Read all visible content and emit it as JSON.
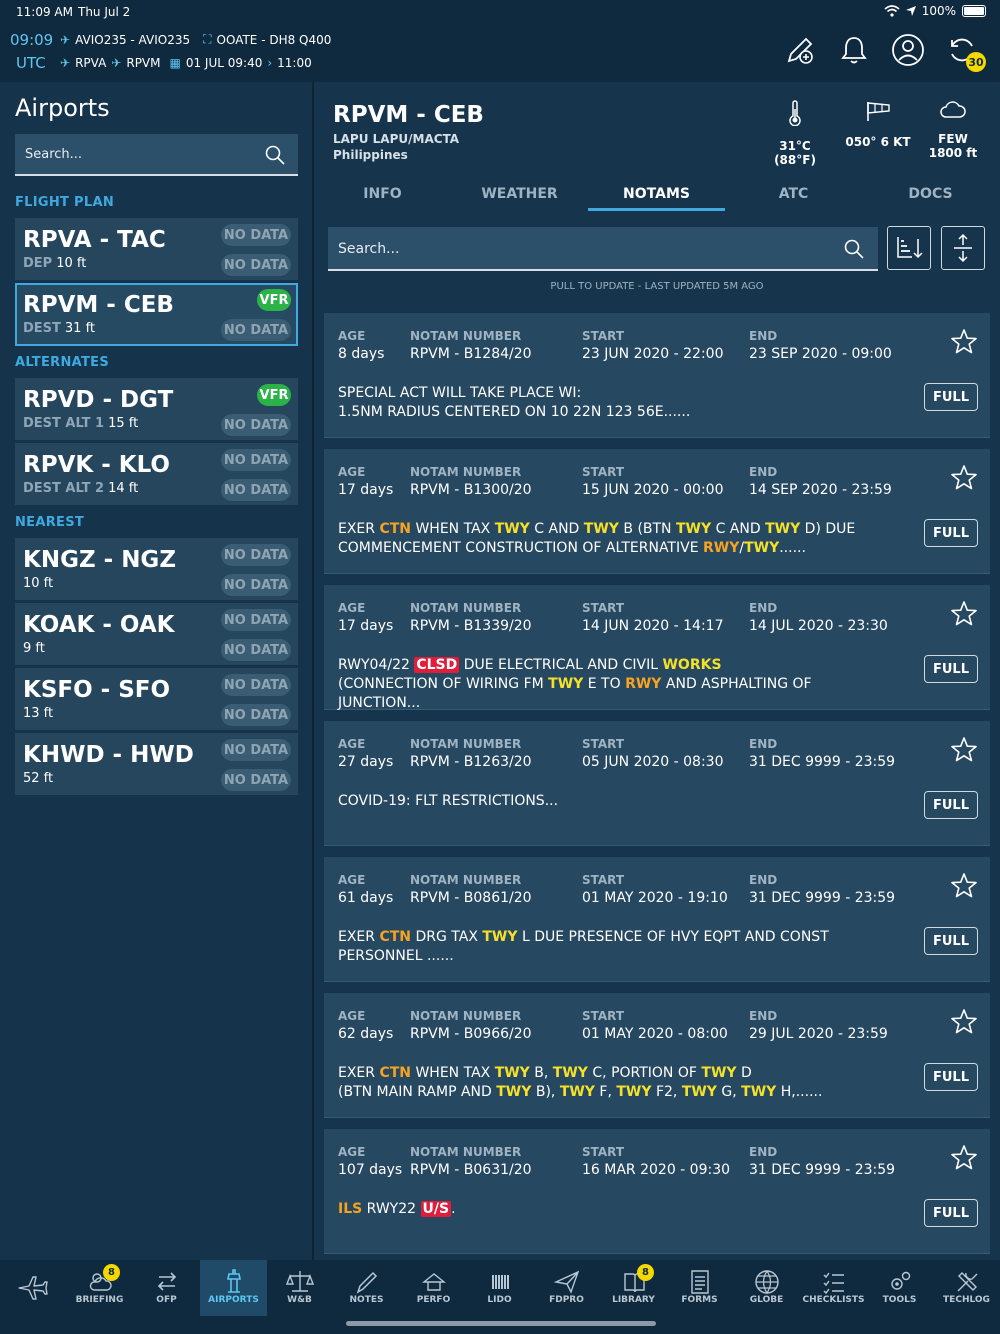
{
  "status": {
    "time": "11:09 AM",
    "date": "Thu Jul 2",
    "battery": "100%"
  },
  "flight": {
    "utc_time": "09:09",
    "utc_label": "UTC",
    "flight_numbers": "AVIO235 - AVIO235",
    "aircraft": "OOATE - DH8 Q400",
    "origin": "RPVA",
    "destination": "RPVM",
    "schedule_date": "01 JUL 09:40",
    "schedule_arrival": "11:00",
    "sync_count": "30"
  },
  "sidebar": {
    "title": "Airports",
    "search_placeholder": "Search...",
    "sections": {
      "flight_plan": "FLIGHT PLAN",
      "alternates": "ALTERNATES",
      "nearest": "NEAREST"
    },
    "airports": [
      {
        "code": "RPVA - TAC",
        "sub_key": "DEP",
        "elev": "10 ft",
        "top_badge": "NO DATA",
        "bottom_badge": "NO DATA"
      },
      {
        "code": "RPVM - CEB",
        "sub_key": "DEST",
        "elev": "31 ft",
        "top_badge": "VFR",
        "bottom_badge": "NO DATA"
      },
      {
        "code": "RPVD - DGT",
        "sub_key": "DEST ALT 1",
        "elev": "15 ft",
        "top_badge": "VFR",
        "bottom_badge": "NO DATA"
      },
      {
        "code": "RPVK - KLO",
        "sub_key": "DEST ALT 2",
        "elev": "14 ft",
        "top_badge": "NO DATA",
        "bottom_badge": "NO DATA"
      },
      {
        "code": "KNGZ - NGZ",
        "sub_key": "",
        "elev": "10 ft",
        "top_badge": "NO DATA",
        "bottom_badge": "NO DATA"
      },
      {
        "code": "KOAK - OAK",
        "sub_key": "",
        "elev": "9 ft",
        "top_badge": "NO DATA",
        "bottom_badge": "NO DATA"
      },
      {
        "code": "KSFO - SFO",
        "sub_key": "",
        "elev": "13 ft",
        "top_badge": "NO DATA",
        "bottom_badge": "NO DATA"
      },
      {
        "code": "KHWD - HWD",
        "sub_key": "",
        "elev": "52 ft",
        "top_badge": "NO DATA",
        "bottom_badge": "NO DATA"
      }
    ]
  },
  "airport": {
    "title": "RPVM - CEB",
    "name": "LAPU LAPU/MACTA",
    "country": "Philippines",
    "temperature": "31°C (88°F)",
    "wind": "050° 6 KT",
    "cloud_cover": "FEW",
    "cloud_base": "1800 ft"
  },
  "tabs": [
    "INFO",
    "WEATHER",
    "NOTAMS",
    "ATC",
    "DOCS"
  ],
  "notams_view": {
    "search_placeholder": "Search...",
    "pull_text": "PULL TO UPDATE - LAST UPDATED 5M AGO",
    "labels": {
      "age": "AGE",
      "number": "NOTAM NUMBER",
      "start": "START",
      "end": "END",
      "full": "FULL"
    }
  },
  "notams": [
    {
      "age": "8 days",
      "number": "RPVM - B1284/20",
      "start": "23 JUN 2020 - 22:00",
      "end": "23 SEP 2020 - 09:00",
      "lines": [
        [
          {
            "t": "SPECIAL ACT WILL TAKE PLACE WI:"
          }
        ],
        [
          {
            "t": "1.5NM RADIUS CENTERED ON 10 22N 123 56E......"
          }
        ]
      ]
    },
    {
      "age": "17 days",
      "number": "RPVM - B1300/20",
      "start": "15 JUN 2020 - 00:00",
      "end": "14 SEP 2020 - 23:59",
      "lines": [
        [
          {
            "t": "EXER "
          },
          {
            "t": "CTN",
            "h": "o"
          },
          {
            "t": " WHEN TAX "
          },
          {
            "t": "TWY",
            "h": "y"
          },
          {
            "t": " C AND "
          },
          {
            "t": "TWY",
            "h": "y"
          },
          {
            "t": " B (BTN "
          },
          {
            "t": "TWY",
            "h": "y"
          },
          {
            "t": " C AND "
          },
          {
            "t": "TWY",
            "h": "y"
          },
          {
            "t": " D) DUE"
          }
        ],
        [
          {
            "t": "COMMENCEMENT CONSTRUCTION OF ALTERNATIVE "
          },
          {
            "t": "RWY",
            "h": "o"
          },
          {
            "t": "/"
          },
          {
            "t": "TWY",
            "h": "y"
          },
          {
            "t": "......"
          }
        ]
      ]
    },
    {
      "age": "17 days",
      "number": "RPVM - B1339/20",
      "start": "14 JUN 2020 - 14:17",
      "end": "14 JUL 2020 - 23:30",
      "lines": [
        [
          {
            "t": "RWY04/22 "
          },
          {
            "t": "CLSD",
            "h": "r"
          },
          {
            "t": " DUE ELECTRICAL AND CIVIL "
          },
          {
            "t": "WORKS",
            "h": "y"
          }
        ],
        [
          {
            "t": "(CONNECTION OF WIRING FM "
          },
          {
            "t": "TWY",
            "h": "y"
          },
          {
            "t": " E TO "
          },
          {
            "t": "RWY",
            "h": "o"
          },
          {
            "t": " AND ASPHALTING OF JUNCTION..."
          }
        ]
      ]
    },
    {
      "age": "27 days",
      "number": "RPVM - B1263/20",
      "start": "05 JUN 2020 - 08:30",
      "end": "31 DEC 9999 - 23:59",
      "lines": [
        [
          {
            "t": "COVID-19: FLT RESTRICTIONS..."
          }
        ]
      ]
    },
    {
      "age": "61 days",
      "number": "RPVM - B0861/20",
      "start": "01 MAY 2020 - 19:10",
      "end": "31 DEC 9999 - 23:59",
      "lines": [
        [
          {
            "t": "EXER "
          },
          {
            "t": "CTN",
            "h": "o"
          },
          {
            "t": " DRG TAX "
          },
          {
            "t": "TWY",
            "h": "y"
          },
          {
            "t": " L DUE PRESENCE OF HVY EQPT AND CONST"
          }
        ],
        [
          {
            "t": "PERSONNEL ......"
          }
        ]
      ]
    },
    {
      "age": "62 days",
      "number": "RPVM - B0966/20",
      "start": "01 MAY 2020 - 08:00",
      "end": "29 JUL 2020 - 23:59",
      "lines": [
        [
          {
            "t": "EXER "
          },
          {
            "t": "CTN",
            "h": "o"
          },
          {
            "t": " WHEN TAX "
          },
          {
            "t": "TWY",
            "h": "y"
          },
          {
            "t": " B, "
          },
          {
            "t": "TWY",
            "h": "y"
          },
          {
            "t": " C, PORTION OF "
          },
          {
            "t": "TWY",
            "h": "y"
          },
          {
            "t": " D"
          }
        ],
        [
          {
            "t": "(BTN MAIN RAMP AND "
          },
          {
            "t": "TWY",
            "h": "y"
          },
          {
            "t": " B), "
          },
          {
            "t": "TWY",
            "h": "y"
          },
          {
            "t": " F, "
          },
          {
            "t": "TWY",
            "h": "y"
          },
          {
            "t": " F2, "
          },
          {
            "t": "TWY",
            "h": "y"
          },
          {
            "t": " G, "
          },
          {
            "t": "TWY",
            "h": "y"
          },
          {
            "t": " H,......"
          }
        ]
      ]
    },
    {
      "age": "107 days",
      "number": "RPVM - B0631/20",
      "start": "16 MAR 2020 - 09:30",
      "end": "31 DEC 9999 - 23:59",
      "lines": [
        [
          {
            "t": "ILS",
            "h": "o"
          },
          {
            "t": " RWY22 "
          },
          {
            "t": "U/S",
            "h": "r"
          },
          {
            "t": "."
          }
        ]
      ]
    }
  ],
  "bottom_nav": [
    {
      "label": "",
      "icon": "plane-icon"
    },
    {
      "label": "BRIEFING",
      "icon": "weather-icon",
      "badge": "8"
    },
    {
      "label": "OFP",
      "icon": "ofp-icon"
    },
    {
      "label": "AIRPORTS",
      "icon": "tower-icon",
      "active": true
    },
    {
      "label": "W&B",
      "icon": "balance-icon"
    },
    {
      "label": "NOTES",
      "icon": "pencil-icon"
    },
    {
      "label": "PERFO",
      "icon": "perfo-icon"
    },
    {
      "label": "LIDO",
      "icon": "lido-icon"
    },
    {
      "label": "FDPRO",
      "icon": "send-icon"
    },
    {
      "label": "LIBRARY",
      "icon": "book-icon",
      "badge": "8"
    },
    {
      "label": "FORMS",
      "icon": "form-icon"
    },
    {
      "label": "GLOBE",
      "icon": "globe-icon"
    },
    {
      "label": "CHECKLISTS",
      "icon": "checklist-icon"
    },
    {
      "label": "TOOLS",
      "icon": "gears-icon"
    },
    {
      "label": "TECHLOG",
      "icon": "wrench-icon"
    }
  ],
  "colors": {
    "accent": "#3fa9e0",
    "vfr": "#2bb34a",
    "badge": "#f5d800",
    "highlight_orange": "#f7a321",
    "highlight_yellow": "#f5e12a",
    "highlight_red": "#e01e3c"
  }
}
